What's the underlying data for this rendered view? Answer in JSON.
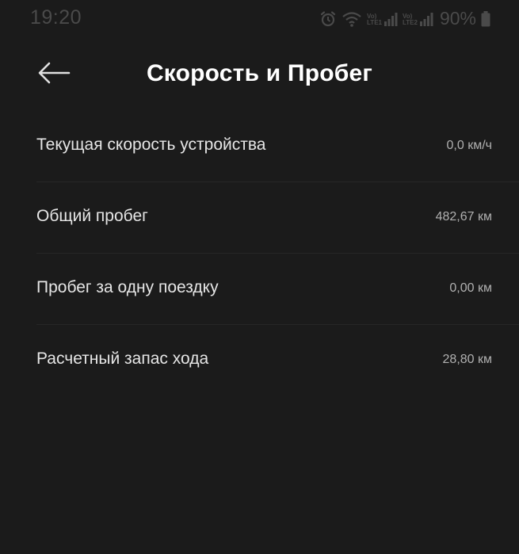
{
  "status_bar": {
    "time": "19:20",
    "sim1_top": "Vo)",
    "sim1_bottom": "LTE1",
    "sim2_top": "Vo)",
    "sim2_bottom": "LTE2",
    "battery": "90%",
    "icons": [
      "alarm-icon",
      "wifi-icon",
      "signal-icon",
      "signal-icon",
      "battery-icon"
    ]
  },
  "header": {
    "title": "Скорость и Пробег",
    "back_icon": "arrow-left-icon"
  },
  "rows": [
    {
      "label": "Текущая скорость устройства",
      "value": "0,0 км/ч"
    },
    {
      "label": "Общий пробег",
      "value": "482,67 км"
    },
    {
      "label": "Пробег за одну поездку",
      "value": "0,00 км"
    },
    {
      "label": "Расчетный запас хода",
      "value": "28,80 км"
    }
  ],
  "colors": {
    "background": "#1b1b1b",
    "title": "#ffffff",
    "label": "#e6e6e6",
    "value": "#b0b0b0",
    "status": "#4a4a4a"
  }
}
